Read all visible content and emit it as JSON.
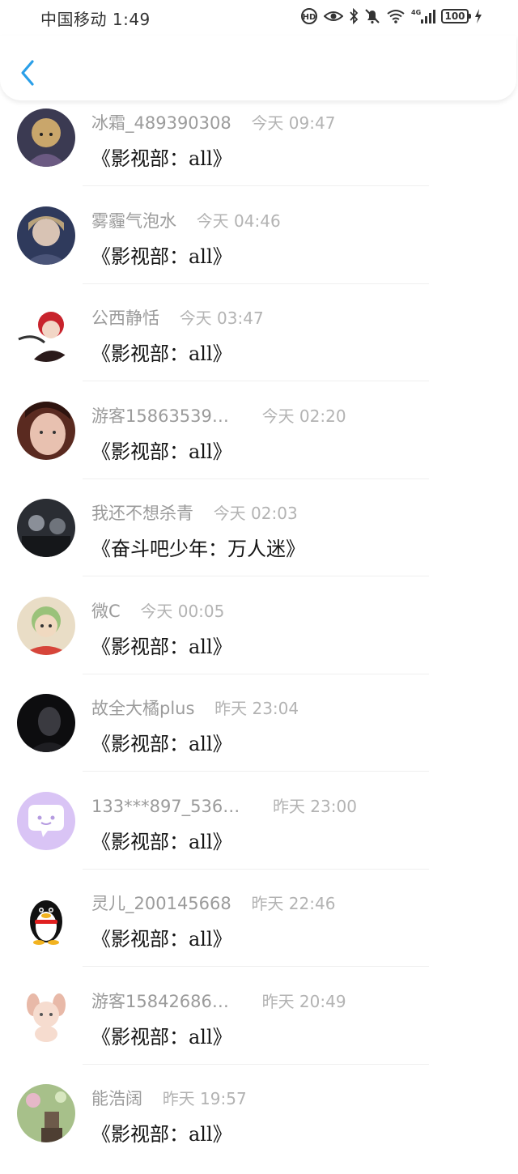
{
  "status_bar": {
    "carrier_time": "中国移动 1:49",
    "network": "4G",
    "battery": "100"
  },
  "header": {
    "back_icon": "chevron-left-icon",
    "accent_color": "#2a9fe8"
  },
  "items": [
    {
      "name": "冰霜_489390308",
      "time": "今天 09:47",
      "title": "《影视部：all》",
      "avatar_icon": "anime-avatar-icon",
      "avatar_colors": [
        "#3b3a52",
        "#c9a66b"
      ]
    },
    {
      "name": "雾霾气泡水",
      "time": "今天 04:46",
      "title": "《影视部：all》",
      "avatar_icon": "anime-avatar-icon",
      "avatar_colors": [
        "#2f3a5c",
        "#d8c3b4"
      ]
    },
    {
      "name": "公西静恬",
      "time": "今天 03:47",
      "title": "《影视部：all》",
      "avatar_icon": "anime-avatar-icon",
      "avatar_colors": [
        "#ffffff",
        "#c8232c"
      ]
    },
    {
      "name": "游客15863539…",
      "time": "今天 02:20",
      "title": "《影视部：all》",
      "avatar_icon": "photo-avatar-icon",
      "avatar_colors": [
        "#5a2a20",
        "#e8c1b0"
      ]
    },
    {
      "name": "我还不想杀青",
      "time": "今天 02:03",
      "title": "《奋斗吧少年：万人迷》",
      "avatar_icon": "photo-avatar-icon",
      "avatar_colors": [
        "#2a2d33",
        "#8a8f98"
      ]
    },
    {
      "name": "微C",
      "time": "今天 00:05",
      "title": "《影视部：all》",
      "avatar_icon": "anime-avatar-icon",
      "avatar_colors": [
        "#9ac27a",
        "#f0d9c0"
      ]
    },
    {
      "name": "故全大橘plus",
      "time": "昨天 23:04",
      "title": "《影视部：all》",
      "avatar_icon": "photo-avatar-icon",
      "avatar_colors": [
        "#0d0d0f",
        "#3a3a40"
      ]
    },
    {
      "name": "133***897_536…",
      "time": "昨天 23:00",
      "title": "《影视部：all》",
      "avatar_icon": "chat-bubble-icon",
      "avatar_colors": [
        "#d9c4f5",
        "#ffffff"
      ]
    },
    {
      "name": "灵儿_200145668",
      "time": "昨天 22:46",
      "title": "《影视部：all》",
      "avatar_icon": "penguin-icon",
      "avatar_colors": [
        "#ffffff",
        "#111111"
      ]
    },
    {
      "name": "游客15842686…",
      "time": "昨天 20:49",
      "title": "《影视部：all》",
      "avatar_icon": "cartoon-dog-icon",
      "avatar_colors": [
        "#ffffff",
        "#e8b9a8"
      ]
    },
    {
      "name": "能浩阔",
      "time": "昨天 19:57",
      "title": "《影视部：all》",
      "avatar_icon": "photo-avatar-icon",
      "avatar_colors": [
        "#a7c08a",
        "#6d5a4a"
      ]
    }
  ]
}
